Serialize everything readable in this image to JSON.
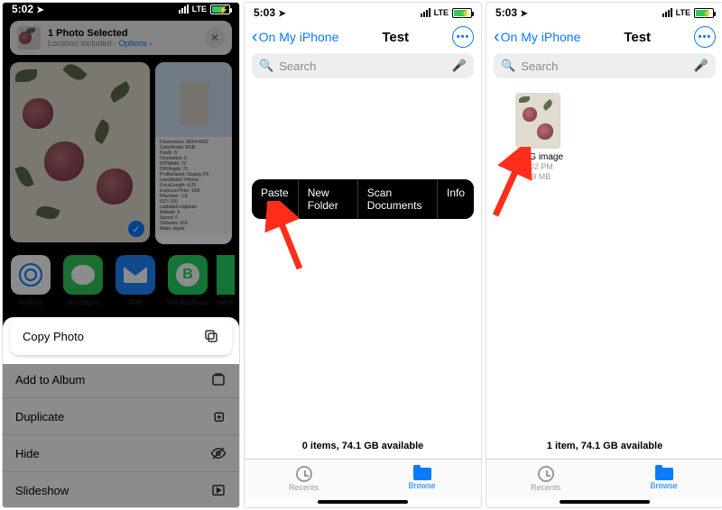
{
  "colors": {
    "ios_blue": "#0a7aff",
    "ios_green": "#34c759",
    "ios_red_arrow": "#ff2d1a"
  },
  "screen1": {
    "status": {
      "time": "5:02",
      "carrier": "LTE"
    },
    "header": {
      "title": "1 Photo Selected",
      "subtitle": "Location Included",
      "options": "Options",
      "close": "✕"
    },
    "apps": {
      "airdrop": "AirDrop",
      "messages": "Messages",
      "mail": "Mail",
      "wa_business": "WA Business",
      "whatsapp": "WhatsApp"
    },
    "actions": {
      "copy": "Copy Photo",
      "add_album": "Add to Album",
      "duplicate": "Duplicate",
      "hide": "Hide",
      "slideshow": "Slideshow"
    }
  },
  "files_common": {
    "back": "On My iPhone",
    "title": "Test",
    "search": "Search",
    "tabs": {
      "recents": "Recents",
      "browse": "Browse"
    }
  },
  "screen2": {
    "status": {
      "time": "5:03",
      "carrier": "LTE"
    },
    "context": {
      "paste": "Paste",
      "new_folder": "New Folder",
      "scan": "Scan Documents",
      "info": "Info"
    },
    "footer": "0 items, 74.1 GB available"
  },
  "screen3": {
    "status": {
      "time": "5:03",
      "carrier": "LTE"
    },
    "file": {
      "name": "JPEG image",
      "time": "5:02 PM",
      "size": "4.9 MB"
    },
    "footer": "1 item, 74.1 GB available"
  }
}
